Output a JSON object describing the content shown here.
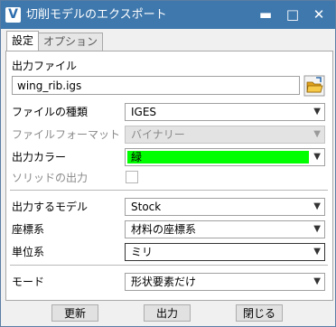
{
  "window": {
    "title": "切削モデルのエクスポート",
    "app_icon_letter": "V",
    "minimize_glyph": "▬",
    "maximize_glyph": "□",
    "close_glyph": "✕"
  },
  "tabs": [
    {
      "label": "設定"
    },
    {
      "label": "オプション"
    }
  ],
  "output_file": {
    "label": "出力ファイル",
    "value": "wing_rib.igs"
  },
  "fields": {
    "file_type": {
      "label": "ファイルの種類",
      "value": "IGES"
    },
    "file_format": {
      "label": "ファイルフォーマット",
      "value": "バイナリー"
    },
    "output_color": {
      "label": "出力カラー",
      "value": "緑",
      "swatch": "#00ff00"
    },
    "solid_output": {
      "label": "ソリッドの出力",
      "checked": false
    },
    "output_model": {
      "label": "出力するモデル",
      "value": "Stock"
    },
    "coordinate_system": {
      "label": "座標系",
      "value": "材料の座標系"
    },
    "units": {
      "label": "単位系",
      "value": "ミリ"
    },
    "mode": {
      "label": "モード",
      "value": "形状要素だけ"
    }
  },
  "buttons": {
    "update": "更新",
    "output": "出力",
    "close": "閉じる"
  },
  "colors": {
    "titlebar": "#3f78ad"
  }
}
